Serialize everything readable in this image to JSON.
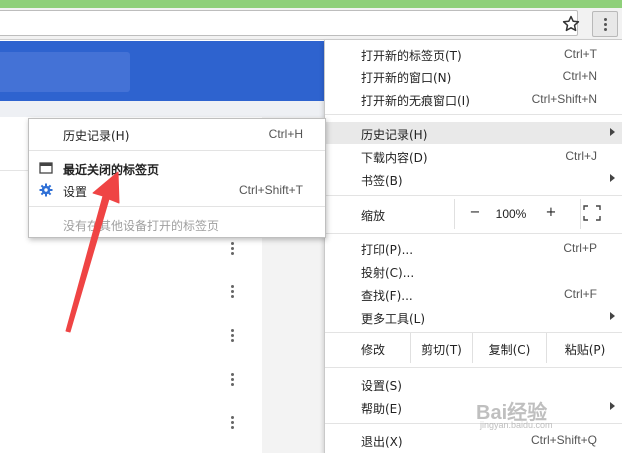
{
  "main_menu": {
    "new_tab": {
      "label": "打开新的标签页(T)",
      "shortcut": "Ctrl+T"
    },
    "new_window": {
      "label": "打开新的窗口(N)",
      "shortcut": "Ctrl+N"
    },
    "incognito": {
      "label": "打开新的无痕窗口(I)",
      "shortcut": "Ctrl+Shift+N"
    },
    "history": {
      "label": "历史记录(H)"
    },
    "downloads": {
      "label": "下载内容(D)",
      "shortcut": "Ctrl+J"
    },
    "bookmarks": {
      "label": "书签(B)"
    },
    "zoom": {
      "label": "缩放",
      "minus": "−",
      "value": "100%",
      "plus": "+"
    },
    "print": {
      "label": "打印(P)...",
      "shortcut": "Ctrl+P"
    },
    "cast": {
      "label": "投射(C)..."
    },
    "find": {
      "label": "查找(F)...",
      "shortcut": "Ctrl+F"
    },
    "more_tools": {
      "label": "更多工具(L)"
    },
    "edit": {
      "label": "修改",
      "cut": "剪切(T)",
      "copy": "复制(C)",
      "paste": "粘贴(P)"
    },
    "settings": {
      "label": "设置(S)"
    },
    "help": {
      "label": "帮助(E)"
    },
    "exit": {
      "label": "退出(X)",
      "shortcut": "Ctrl+Shift+Q"
    }
  },
  "history_submenu": {
    "history": {
      "label": "历史记录(H)",
      "shortcut": "Ctrl+H"
    },
    "recently_closed": {
      "label": "最近关闭的标签页"
    },
    "settings": {
      "label": "设置",
      "shortcut": "Ctrl+Shift+T"
    },
    "no_other_devices": {
      "label": "没有在其他设备打开的标签页"
    }
  },
  "watermark": {
    "brand": "Bai经验",
    "url": "jingyan.baidu.com"
  },
  "colors": {
    "page_header": "#2e63cf",
    "annotation_arrow": "#ef4444",
    "settings_gear": "#2e6fd6"
  },
  "icons": {
    "star": "star-icon",
    "menu": "three-dots-vertical-icon",
    "tab": "tab-window-icon",
    "gear": "gear-icon",
    "fullscreen": "fullscreen-icon"
  }
}
